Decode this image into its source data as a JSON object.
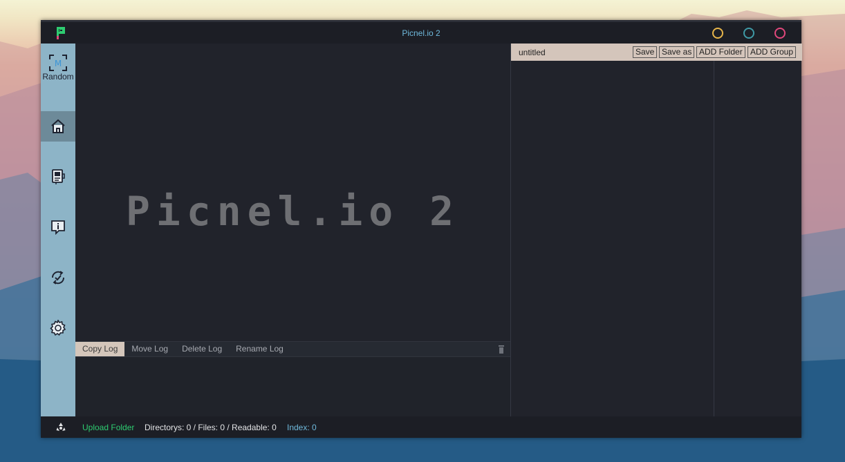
{
  "window": {
    "title": "Picnel.io 2",
    "controls": [
      {
        "name": "minimize-button",
        "color": "#e8b64a"
      },
      {
        "name": "maximize-button",
        "color": "#3f9aa6"
      },
      {
        "name": "close-button",
        "color": "#e2487c"
      }
    ]
  },
  "sidebar": {
    "random_label": "Random",
    "items": [
      {
        "name": "home",
        "icon": "home-icon",
        "active": true
      },
      {
        "name": "device",
        "icon": "device-icon",
        "active": false
      },
      {
        "name": "info",
        "icon": "info-bubble-icon",
        "active": false
      },
      {
        "name": "check",
        "icon": "check-cycle-icon",
        "active": false
      },
      {
        "name": "settings",
        "icon": "gear-icon",
        "active": false
      }
    ]
  },
  "main": {
    "splash_text": "Picnel.io 2"
  },
  "logbar": {
    "tabs": [
      "Copy Log",
      "Move Log",
      "Delete Log",
      "Rename Log"
    ],
    "active_tab": "Copy Log"
  },
  "right_panel": {
    "filename": "untitled",
    "buttons": {
      "save": "Save",
      "save_as": "Save as",
      "add_folder": "ADD Folder",
      "add_group": "ADD Group"
    }
  },
  "statusbar": {
    "upload_label": "Upload Folder",
    "counts": "Directorys: 0 / Files: 0 / Readable: 0",
    "index_label": "Index:",
    "index_value": "0"
  },
  "colors": {
    "accent_blue": "#6fb9dc",
    "upload_green": "#2ecc71",
    "sidebar_bg": "#8db4c7",
    "panel_header": "#d4c5bb"
  }
}
